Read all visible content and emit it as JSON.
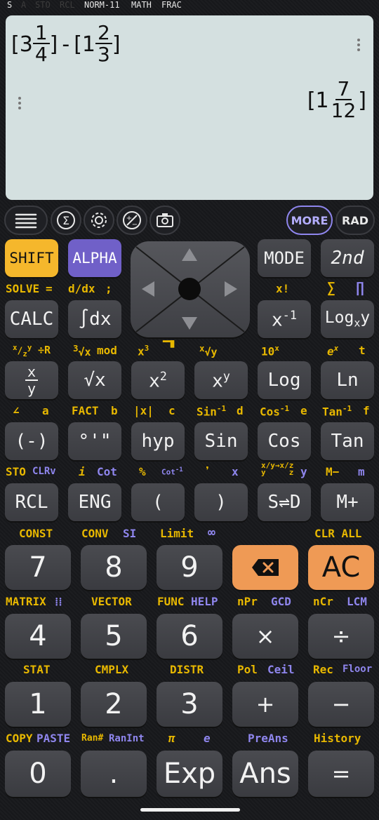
{
  "status": {
    "s": "S",
    "a": "A",
    "sto": "STO",
    "rcl": "RCL",
    "norm": "NORM-11",
    "math": "MATH",
    "frac": "FRAC"
  },
  "display": {
    "expr": {
      "w1": "3",
      "n1": "1",
      "d1": "4",
      "minus": "-",
      "w2": "1",
      "n2": "2",
      "d2": "3"
    },
    "result": {
      "w": "1",
      "n": "7",
      "d": "12"
    }
  },
  "toolbar": {
    "more": "MORE",
    "rad": "RAD"
  },
  "keys": {
    "shift": "SHIFT",
    "alpha": "ALPHA",
    "mode": "MODE",
    "second": "2nd",
    "calc": "CALC",
    "int": "∫dx",
    "log": "Log",
    "ln": "Ln",
    "neg": "(-)",
    "deg": "°'\"",
    "hyp": "hyp",
    "sin": "Sin",
    "cos": "Cos",
    "tan": "Tan",
    "rcl": "RCL",
    "eng": "ENG",
    "lparen": "(",
    "rparen": ")",
    "sd": "S⇌D",
    "mplus": "M+",
    "d7": "7",
    "d8": "8",
    "d9": "9",
    "ac": "AC",
    "d4": "4",
    "d5": "5",
    "d6": "6",
    "mul": "×",
    "div": "÷",
    "d1": "1",
    "d2": "2",
    "d3": "3",
    "plus": "+",
    "minus": "−",
    "d0": "0",
    "dot": ".",
    "exp": "Exp",
    "ans": "Ans",
    "eq": "="
  },
  "labels": {
    "solve": "SOLVE",
    "solve_eq": "=",
    "ddx": "d/dx",
    "semi": ";",
    "xfact": "x!",
    "sigma": "∑",
    "pi": "∏",
    "r2_mixed": "÷R",
    "r2_mod": "mod",
    "r2_t": "t",
    "r3_a": "a",
    "r3_fact": "FACT",
    "r3_b": "b",
    "r3_abs": "|x|",
    "r3_c": "c",
    "r3_d": "d",
    "r3_e": "e",
    "r3_f": "f",
    "r4_sto": "STO",
    "r4_clrv": "CLRv",
    "r4_i": "i",
    "r4_cot": "Cot",
    "r4_pct": "%",
    "r4_comma": "❜",
    "r4_x": "x",
    "r4_y": "y",
    "r4_mminus": "M−",
    "r4_m": "m",
    "const": "CONST",
    "conv": "CONV",
    "si": "SI",
    "limit": "Limit",
    "inf": "∞",
    "clrall": "CLR ALL",
    "matrix": "MATRIX",
    "vector": "VECTOR",
    "func": "FUNC",
    "help": "HELP",
    "npr": "nPr",
    "gcd": "GCD",
    "ncr": "nCr",
    "lcm": "LCM",
    "stat": "STAT",
    "cmplx": "CMPLX",
    "distr": "DISTR",
    "pol": "Pol",
    "ceil": "Ceil",
    "rec": "Rec",
    "floor": "Floor",
    "copy": "COPY",
    "paste": "PASTE",
    "ran": "Ran#",
    "ranint": "RanInt",
    "pi_sym": "π",
    "e_sym": "e",
    "preans": "PreAns",
    "history": "History"
  },
  "colors": {
    "yellow": "#e8b800",
    "purple": "#8f86ee",
    "shift": "#f5b72c",
    "alpha": "#7060c8",
    "orange": "#ef9a55",
    "screen": "#d4e0e0"
  }
}
